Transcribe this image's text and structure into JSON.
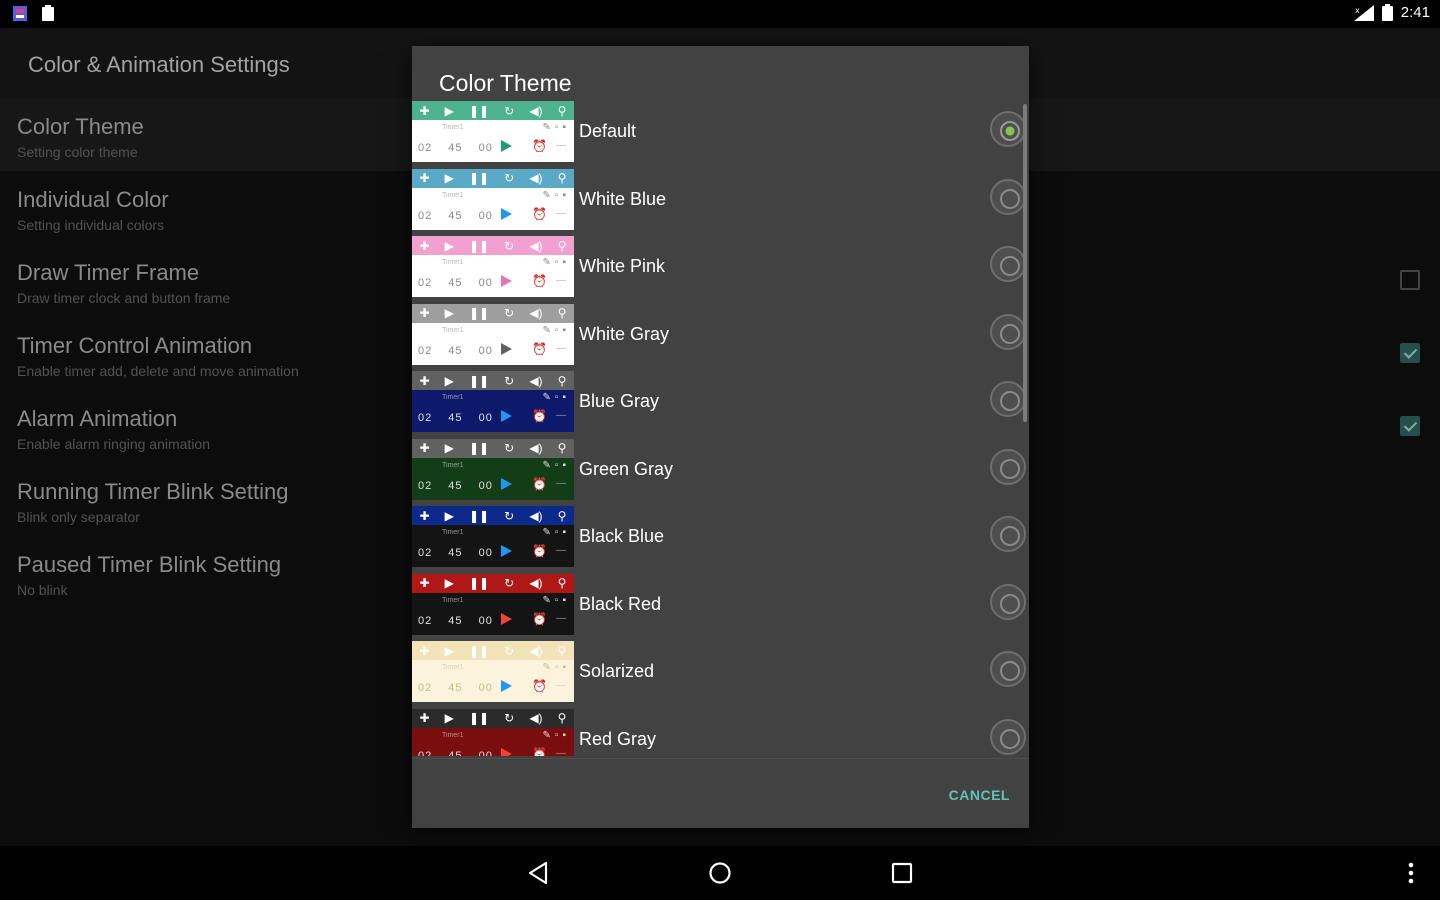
{
  "status_bar": {
    "time": "2:41"
  },
  "app_bar": {
    "title": "Color & Animation Settings"
  },
  "preferences": [
    {
      "title": "Color Theme",
      "summary": "Setting color theme",
      "has_checkbox": false
    },
    {
      "title": "Individual Color",
      "summary": "Setting individual colors",
      "has_checkbox": false
    },
    {
      "title": "Draw Timer Frame",
      "summary": "Draw timer clock and button frame",
      "has_checkbox": true,
      "checked": false
    },
    {
      "title": "Timer Control Animation",
      "summary": "Enable timer add, delete and move animation",
      "has_checkbox": true,
      "checked": true
    },
    {
      "title": "Alarm Animation",
      "summary": "Enable alarm ringing animation",
      "has_checkbox": true,
      "checked": true
    },
    {
      "title": "Running Timer Blink Setting",
      "summary": "Blink only separator",
      "has_checkbox": false
    },
    {
      "title": "Paused Timer Blink Setting",
      "summary": "No blink",
      "has_checkbox": false
    }
  ],
  "dialog": {
    "title": "Color Theme",
    "cancel_label": "CANCEL",
    "preview": {
      "label": "Timer1",
      "time": "02 45 00"
    },
    "themes": [
      {
        "name": "Default",
        "selected": true,
        "bar": "#4db38f",
        "body": "#ffffff",
        "text": "#8a8a8a",
        "play": "#1f9d7a"
      },
      {
        "name": "White Blue",
        "selected": false,
        "bar": "#5aa9c6",
        "body": "#ffffff",
        "text": "#8a8a8a",
        "play": "#2196f3"
      },
      {
        "name": "White Pink",
        "selected": false,
        "bar": "#f2a0d0",
        "body": "#ffffff",
        "text": "#8a8a8a",
        "play": "#e573b5"
      },
      {
        "name": "White Gray",
        "selected": false,
        "bar": "#9e9e9e",
        "body": "#ffffff",
        "text": "#8a8a8a",
        "play": "#616161"
      },
      {
        "name": "Blue Gray",
        "selected": false,
        "bar": "#616161",
        "body": "#0d1a6b",
        "text": "#e0e0e0",
        "play": "#2196f3"
      },
      {
        "name": "Green Gray",
        "selected": false,
        "bar": "#616161",
        "body": "#123d16",
        "text": "#e0e0e0",
        "play": "#2196f3"
      },
      {
        "name": "Black Blue",
        "selected": false,
        "bar": "#0d2a8a",
        "body": "#141414",
        "text": "#e0e0e0",
        "play": "#2196f3"
      },
      {
        "name": "Black Red",
        "selected": false,
        "bar": "#b01818",
        "body": "#141414",
        "text": "#e0e0e0",
        "play": "#f44336"
      },
      {
        "name": "Solarized",
        "selected": false,
        "bar": "#f2e4b8",
        "body": "#fbf3dc",
        "text": "#c9b98a",
        "play": "#2196f3"
      },
      {
        "name": "Red Gray",
        "selected": false,
        "bar": "#2b2b2b",
        "body": "#7a0e0e",
        "text": "#e0e0e0",
        "play": "#f44336"
      }
    ]
  },
  "colors": {
    "accent": "#5fc4b5",
    "radio_selected": "#8bc34a",
    "dialog_bg": "#424242"
  }
}
